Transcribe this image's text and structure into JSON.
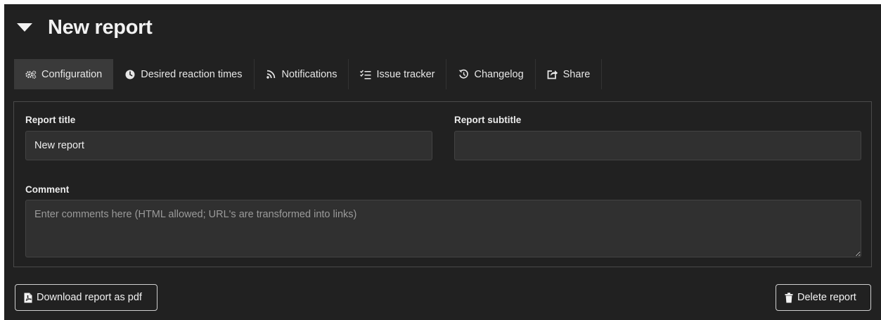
{
  "header": {
    "title": "New report",
    "toggle_icon": "caret-down-icon"
  },
  "tabs": [
    {
      "label": "Configuration",
      "icon": "cogs-icon",
      "active": true
    },
    {
      "label": "Desired reaction times",
      "icon": "clock-icon",
      "active": false
    },
    {
      "label": "Notifications",
      "icon": "feed-icon",
      "active": false
    },
    {
      "label": "Issue tracker",
      "icon": "tasks-icon",
      "active": false
    },
    {
      "label": "Changelog",
      "icon": "history-icon",
      "active": false
    },
    {
      "label": "Share",
      "icon": "share-icon",
      "active": false
    }
  ],
  "form": {
    "report_title": {
      "label": "Report title",
      "value": "New report"
    },
    "report_subtitle": {
      "label": "Report subtitle",
      "value": ""
    },
    "comment": {
      "label": "Comment",
      "value": "",
      "placeholder": "Enter comments here (HTML allowed; URL's are transformed into links)"
    }
  },
  "actions": {
    "download_label": "Download report as pdf",
    "delete_label": "Delete report"
  },
  "colors": {
    "background": "#212121",
    "active_tab": "#3a3a3a",
    "input_background": "#303030",
    "text": "#e6e6e6"
  }
}
